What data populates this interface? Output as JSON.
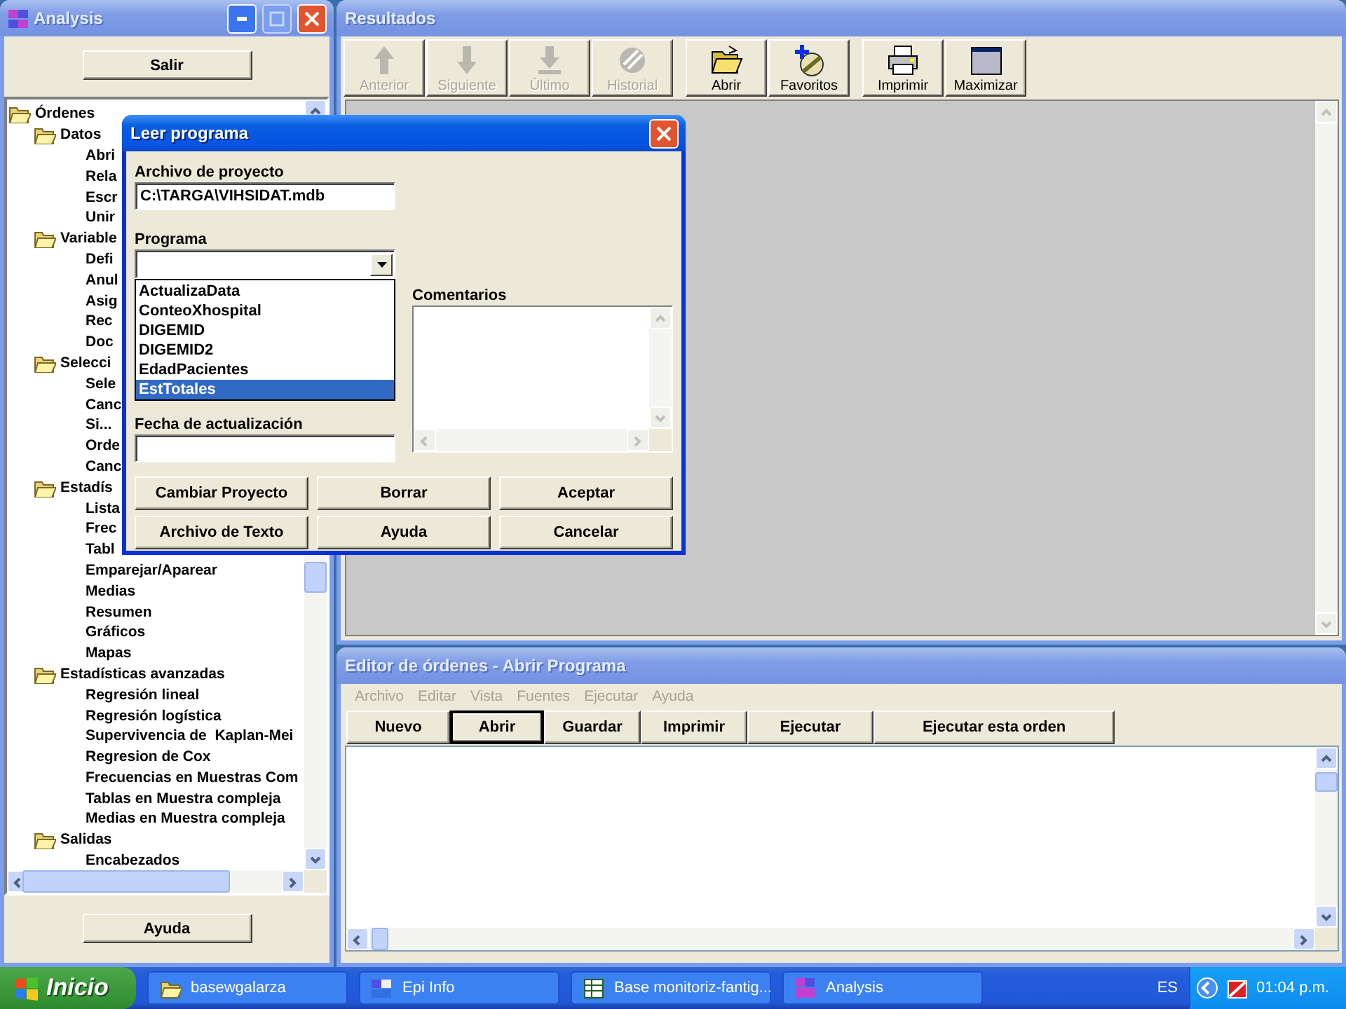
{
  "analysis_window": {
    "title": "Analysis",
    "exit_button": "Salir",
    "tree": [
      {
        "label": "Órdenes",
        "kind": "folder",
        "children": [
          {
            "label": "Datos",
            "kind": "folder",
            "children": [
              {
                "label": "Abri",
                "kind": "command"
              },
              {
                "label": "Rela",
                "kind": "command"
              },
              {
                "label": "Escr",
                "kind": "command"
              },
              {
                "label": "Unir",
                "kind": "command"
              }
            ]
          },
          {
            "label": "Variable",
            "kind": "folder",
            "children": [
              {
                "label": "Defi",
                "kind": "command"
              },
              {
                "label": "Anul",
                "kind": "command"
              },
              {
                "label": "Asig",
                "kind": "command"
              },
              {
                "label": "Rec",
                "kind": "command"
              },
              {
                "label": "Doc",
                "kind": "command"
              }
            ]
          },
          {
            "label": "Selecci",
            "kind": "folder",
            "children": [
              {
                "label": "Sele",
                "kind": "command"
              },
              {
                "label": "Canc",
                "kind": "command"
              },
              {
                "label": "Si...",
                "kind": "command"
              },
              {
                "label": "Orde",
                "kind": "command"
              },
              {
                "label": "Canc",
                "kind": "command"
              }
            ]
          },
          {
            "label": "Estadís",
            "kind": "folder",
            "children": [
              {
                "label": "Lista",
                "kind": "command"
              },
              {
                "label": "Frec",
                "kind": "command"
              },
              {
                "label": "Tabl",
                "kind": "command"
              },
              {
                "label": "Emparejar/Aparear",
                "kind": "command"
              },
              {
                "label": "Medias",
                "kind": "command"
              },
              {
                "label": "Resumen",
                "kind": "command"
              },
              {
                "label": "Gráficos",
                "kind": "command"
              },
              {
                "label": "Mapas",
                "kind": "command"
              }
            ]
          },
          {
            "label": "Estadísticas avanzadas",
            "kind": "folder",
            "children": [
              {
                "label": "Regresión lineal",
                "kind": "command"
              },
              {
                "label": "Regresión logística",
                "kind": "command"
              },
              {
                "label": "Supervivencia de  Kaplan-Mei",
                "kind": "command"
              },
              {
                "label": "Regresion de Cox",
                "kind": "command"
              },
              {
                "label": "Frecuencias en Muestras Com",
                "kind": "command"
              },
              {
                "label": "Tablas en Muestra compleja",
                "kind": "command"
              },
              {
                "label": "Medias en Muestra compleja",
                "kind": "command"
              }
            ]
          },
          {
            "label": "Salidas",
            "kind": "folder",
            "children": [
              {
                "label": "Encabezados",
                "kind": "command"
              }
            ]
          }
        ]
      }
    ],
    "help_button": "Ayuda"
  },
  "results_window": {
    "title": "Resultados",
    "toolbar_groups": [
      [
        {
          "label": "Anterior",
          "disabled": true
        },
        {
          "label": "Siguiente",
          "disabled": true
        },
        {
          "label": "Último",
          "disabled": true
        },
        {
          "label": "Historial",
          "disabled": true
        }
      ],
      [
        {
          "label": "Abrir",
          "disabled": false
        },
        {
          "label": "Favoritos",
          "disabled": false
        }
      ],
      [
        {
          "label": "Imprimir",
          "disabled": false
        },
        {
          "label": "Maximizar",
          "disabled": false
        }
      ]
    ]
  },
  "editor_window": {
    "title": "Editor de órdenes - Abrir Programa",
    "menu": [
      {
        "label": "Archivo",
        "disabled": true
      },
      {
        "label": "Editar",
        "disabled": true
      },
      {
        "label": "Vista",
        "disabled": true
      },
      {
        "label": "Fuentes",
        "disabled": true
      },
      {
        "label": "Ejecutar",
        "disabled": true
      },
      {
        "label": "Ayuda",
        "disabled": true
      }
    ],
    "buttons": [
      {
        "label": "Nuevo",
        "selected": false
      },
      {
        "label": "Abrir",
        "selected": true
      },
      {
        "label": "Guardar",
        "selected": false
      },
      {
        "label": "Imprimir",
        "selected": false
      },
      {
        "label": "Ejecutar",
        "selected": false
      },
      {
        "label": "Ejecutar esta orden",
        "selected": false
      }
    ]
  },
  "dialog": {
    "title": "Leer programa",
    "project_label": "Archivo de proyecto",
    "project_value": "C:\\TARGA\\VIHSIDAT.mdb",
    "program_label": "Programa",
    "program_options": [
      {
        "label": "ActualizaData",
        "selected": false
      },
      {
        "label": "ConteoXhospital",
        "selected": false
      },
      {
        "label": "DIGEMID",
        "selected": false
      },
      {
        "label": "DIGEMID2",
        "selected": false
      },
      {
        "label": "EdadPacientes",
        "selected": false
      },
      {
        "label": "EstTotales",
        "selected": true
      }
    ],
    "date_label": "Fecha de actualización",
    "comments_label": "Comentarios",
    "buttons": [
      "Cambiar Proyecto",
      "Borrar",
      "Aceptar",
      "Archivo de Texto",
      "Ayuda",
      "Cancelar"
    ]
  },
  "taskbar": {
    "start": "Inicio",
    "tasks": [
      {
        "label": "basewgalarza"
      },
      {
        "label": "Epi Info"
      },
      {
        "label": "Base monitoriz-fantig..."
      },
      {
        "label": "Analysis"
      }
    ],
    "language": "ES",
    "clock": "01:04 p.m."
  }
}
